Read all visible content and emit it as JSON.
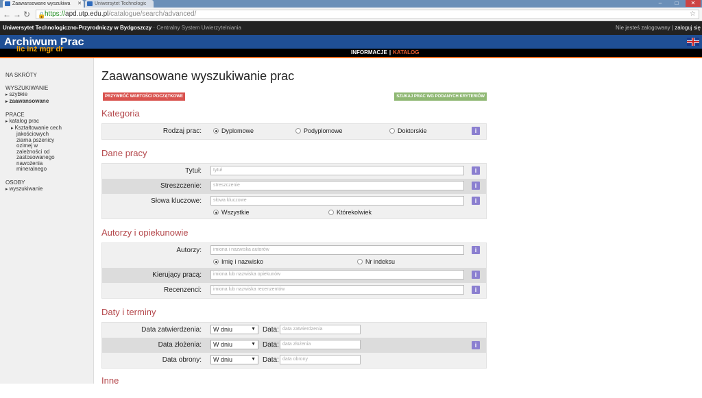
{
  "browser": {
    "tabs": [
      {
        "label": "Zaawansowane wyszukiwa"
      },
      {
        "label": "Uniwersytet Technologic"
      }
    ],
    "url_scheme": "https://",
    "url_host": "apd.utp.edu.pl",
    "url_path": "/catalogue/search/advanced/"
  },
  "header": {
    "university": "Uniwersytet Technologiczno-Przyrodniczy w Bydgoszczy",
    "system": " · Centralny System Uwierzytelniania",
    "not_logged": "Nie jesteś zalogowany",
    "login_sep": " | ",
    "login": "zaloguj się",
    "app_title": "Archiwum Prac",
    "degrees": "lic inż mgr dr",
    "menu_info": "INFORMACJE",
    "menu_sep": "|",
    "menu_catalog": "KATALOG"
  },
  "sidebar": {
    "shortcuts": "NA SKRÓTY",
    "search_title": "WYSZUKIWANIE",
    "search_items": [
      "szybkie",
      "zaawansowane"
    ],
    "works_title": "PRACE",
    "works_item": "katalog prac",
    "works_subitem": "Kształtowanie cech",
    "works_subtext": [
      "jakościowych",
      "ziarna pszenicy",
      "ozimej w",
      "zależności od",
      "zastosowanego",
      "nawożenia",
      "mineralnego"
    ],
    "people_title": "OSOBY",
    "people_item": "wyszukiwanie"
  },
  "main": {
    "title": "Zaawansowane wyszukiwanie prac",
    "reset_btn": "PRZYWRÓĆ WARTOŚCI POCZĄTKOWE",
    "search_btn": "SZUKAJ PRAC WG PODANYCH KRYTERIÓW",
    "info_glyph": "i",
    "category": {
      "title": "Kategoria",
      "label": "Rodzaj prac:",
      "options": [
        "Dyplomowe",
        "Podyplomowe",
        "Doktorskie"
      ]
    },
    "work": {
      "title": "Dane pracy",
      "title_label": "Tytuł:",
      "title_ph": "tytuł",
      "abstract_label": "Streszczenie:",
      "abstract_ph": "streszczenie",
      "keywords_label": "Słowa kluczowe:",
      "keywords_ph": "słowa kluczowe",
      "kw_options": [
        "Wszystkie",
        "Którekolwiek"
      ]
    },
    "authors": {
      "title": "Autorzy i opiekunowie",
      "authors_label": "Autorzy:",
      "authors_ph": "imiona i nazwiska autorów",
      "author_options": [
        "Imię i nazwisko",
        "Nr indeksu"
      ],
      "supervisor_label": "Kierujący pracą:",
      "supervisor_ph": "imiona lub nazwiska opiekunów",
      "reviewer_label": "Recenzenci:",
      "reviewer_ph": "imiona lub nazwiska recenzentów"
    },
    "dates": {
      "title": "Daty i terminy",
      "data_label": "Data:",
      "select_value": "W dniu",
      "rows": [
        {
          "label": "Data zatwierdzenia:",
          "ph": "data zatwierdzenia"
        },
        {
          "label": "Data złożenia:",
          "ph": "data złożenia"
        },
        {
          "label": "Data obrony:",
          "ph": "data obrony"
        }
      ]
    },
    "other": {
      "title": "Inne"
    }
  }
}
